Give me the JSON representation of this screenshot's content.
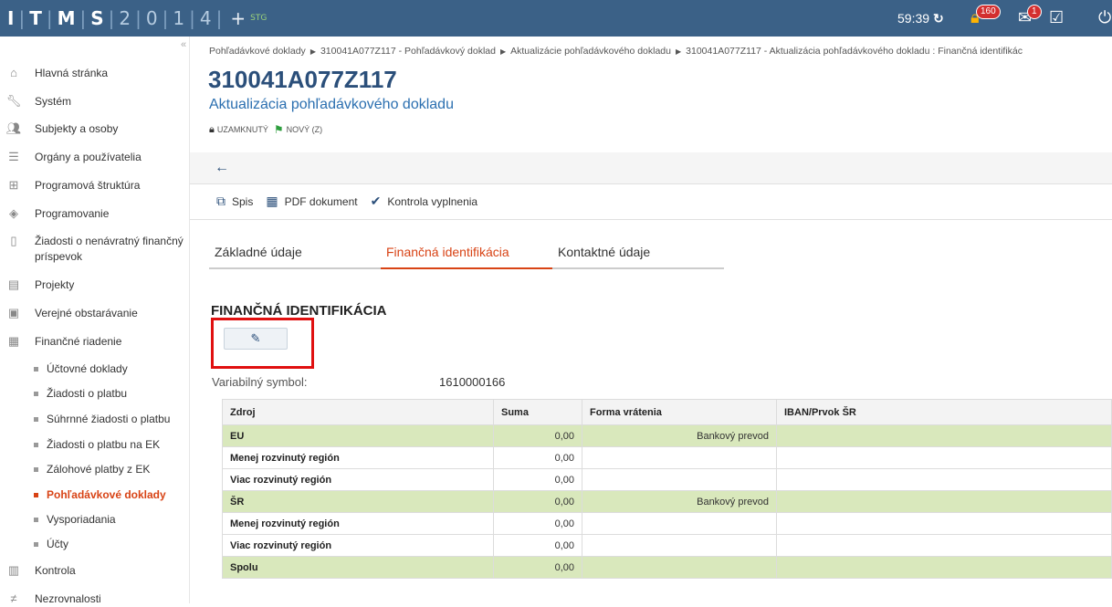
{
  "topbar": {
    "logo": {
      "letters_bold": [
        "I",
        "T",
        "M",
        "S"
      ],
      "letters_light": [
        "2",
        "0",
        "1",
        "4"
      ],
      "plus": "+",
      "env": "STG"
    },
    "timer": "59:39",
    "lock_badge": "160",
    "mail_badge": "1"
  },
  "sidebar": {
    "items": [
      {
        "label": "Hlavná stránka",
        "icon": "home-icon"
      },
      {
        "label": "Systém",
        "icon": "wrench-icon"
      },
      {
        "label": "Subjekty a osoby",
        "icon": "people-icon"
      },
      {
        "label": "Orgány a používatelia",
        "icon": "users-list-icon"
      },
      {
        "label": "Programová štruktúra",
        "icon": "hierarchy-icon"
      },
      {
        "label": "Programovanie",
        "icon": "cubes-icon"
      },
      {
        "label": "Žiadosti o nenávratný finančný príspevok",
        "icon": "document-icon"
      },
      {
        "label": "Projekty",
        "icon": "folder-icon"
      },
      {
        "label": "Verejné obstarávanie",
        "icon": "cart-icon"
      },
      {
        "label": "Finančné riadenie",
        "icon": "money-icon"
      }
    ],
    "sub_items": [
      {
        "label": "Účtovné doklady"
      },
      {
        "label": "Žiadosti o platbu"
      },
      {
        "label": "Súhrnné žiadosti o platbu"
      },
      {
        "label": "Žiadosti o platbu na EK"
      },
      {
        "label": "Zálohové platby z EK"
      },
      {
        "label": "Pohľadávkové doklady",
        "active": true
      },
      {
        "label": "Vysporiadania"
      },
      {
        "label": "Účty"
      }
    ],
    "bottom_items": [
      {
        "label": "Kontrola",
        "icon": "checklist-icon"
      },
      {
        "label": "Nezrovnalosti",
        "icon": "not-equal-icon"
      }
    ]
  },
  "breadcrumb": {
    "items": [
      "Pohľadávkové doklady",
      "310041A077Z117 - Pohľadávkový doklad",
      "Aktualizácie pohľadávkového dokladu",
      "310041A077Z117 - Aktualizácia pohľadávkového dokladu : Finančná identifikác"
    ]
  },
  "header": {
    "title": "310041A077Z117",
    "subtitle": "Aktualizácia pohľadávkového dokladu",
    "status_locked": "UZAMKNUTÝ",
    "status_new": "NOVÝ (Z)"
  },
  "toolbar": {
    "spis": "Spis",
    "pdf": "PDF dokument",
    "kontrola": "Kontrola vyplnenia"
  },
  "tabs": [
    {
      "label": "Základné údaje",
      "active": false
    },
    {
      "label": "Finančná identifikácia",
      "active": true
    },
    {
      "label": "Kontaktné údaje",
      "active": false
    }
  ],
  "section": {
    "title": "FINANČNÁ IDENTIFIKÁCIA",
    "vs_label": "Variabilný symbol:",
    "vs_value": "1610000166"
  },
  "table": {
    "headers": [
      "Zdroj",
      "Suma",
      "Forma vrátenia",
      "IBAN/Prvok ŠR"
    ],
    "rows": [
      {
        "zdroj": "EU",
        "suma": "0,00",
        "forma": "Bankový prevod",
        "iban": "",
        "green": true
      },
      {
        "zdroj": "Menej rozvinutý región",
        "suma": "0,00",
        "forma": "",
        "iban": "",
        "green": false
      },
      {
        "zdroj": "Viac rozvinutý región",
        "suma": "0,00",
        "forma": "",
        "iban": "",
        "green": false
      },
      {
        "zdroj": "ŠR",
        "suma": "0,00",
        "forma": "Bankový prevod",
        "iban": "",
        "green": true
      },
      {
        "zdroj": "Menej rozvinutý región",
        "suma": "0,00",
        "forma": "",
        "iban": "",
        "green": false
      },
      {
        "zdroj": "Viac rozvinutý región",
        "suma": "0,00",
        "forma": "",
        "iban": "",
        "green": false
      },
      {
        "zdroj": "Spolu",
        "suma": "0,00",
        "forma": "",
        "iban": "",
        "green": true
      }
    ]
  },
  "colors": {
    "topbar": "#3b6187",
    "accent": "#d84315",
    "title": "#2b4f7a",
    "highlight": "#e01010",
    "row_green": "#d9e8bc"
  }
}
